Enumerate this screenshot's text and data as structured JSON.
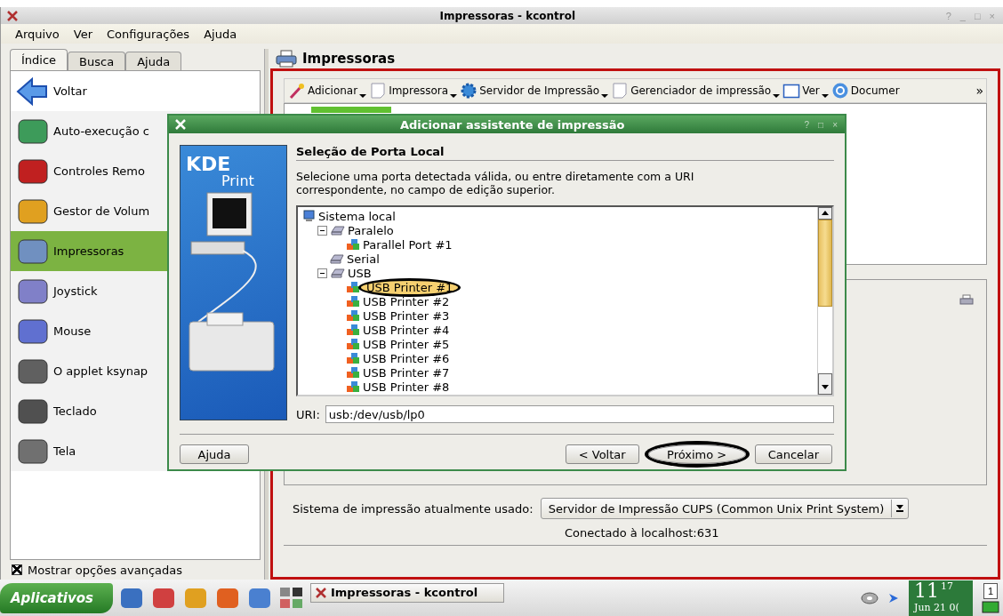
{
  "window": {
    "title": "Impressoras - kcontrol",
    "controls": [
      "?",
      "_",
      "□",
      "×"
    ]
  },
  "menu": [
    "Arquivo",
    "Ver",
    "Configurações",
    "Ajuda"
  ],
  "tabs": [
    {
      "label": "Índice",
      "selected": true
    },
    {
      "label": "Busca",
      "selected": false
    },
    {
      "label": "Ajuda",
      "selected": false
    }
  ],
  "sidebar": {
    "items": [
      {
        "label": "Voltar",
        "kind": "back",
        "selected": false
      },
      {
        "label": "Auto-execução c",
        "kind": "autorun",
        "selected": false
      },
      {
        "label": "Controles Remo",
        "kind": "remote",
        "selected": false
      },
      {
        "label": "Gestor de Volum",
        "kind": "volume",
        "selected": false
      },
      {
        "label": "Impressoras",
        "kind": "printer",
        "selected": true
      },
      {
        "label": "Joystick",
        "kind": "joystick",
        "selected": false
      },
      {
        "label": "Mouse",
        "kind": "mouse",
        "selected": false
      },
      {
        "label": "O applet ksynap",
        "kind": "touchpad",
        "selected": false
      },
      {
        "label": "Teclado",
        "kind": "keyboard",
        "selected": false
      },
      {
        "label": "Tela",
        "kind": "display",
        "selected": false
      }
    ],
    "advanced": {
      "label": "Mostrar opções avançadas",
      "checked": true
    }
  },
  "panel": {
    "title": "Impressoras",
    "toolbar": [
      {
        "label": "Adicionar",
        "kind": "wand"
      },
      {
        "label": "Impressora",
        "kind": "page"
      },
      {
        "label": "Servidor de Impressão",
        "kind": "gear"
      },
      {
        "label": "Gerenciador de impressão",
        "kind": "page"
      },
      {
        "label": "Ver",
        "kind": "window"
      },
      {
        "label": "Documer",
        "kind": "help"
      }
    ],
    "toolbar_more": "»",
    "system_label": "Sistema de impressão atualmente usado:",
    "system_value": "Servidor de Impressão CUPS (Common Unix Print System)",
    "status": "Conectado à localhost:631"
  },
  "dialog": {
    "title": "Adicionar assistente de impressão",
    "controls": [
      "?",
      "□",
      "×"
    ],
    "logo": [
      "KDE",
      "Print"
    ],
    "heading": "Seleção de Porta Local",
    "description": "Selecione uma porta detectada válida, ou entre diretamente com a URI correspondente, no campo de edição superior.",
    "tree": [
      {
        "label": "Sistema local",
        "kind": "computer",
        "selected": false,
        "children": [
          {
            "label": "Paralelo",
            "kind": "port",
            "expanded": true,
            "selected": false,
            "children": [
              {
                "label": "Parallel Port #1",
                "kind": "device",
                "selected": false
              }
            ]
          },
          {
            "label": "Serial",
            "kind": "port",
            "selected": false
          },
          {
            "label": "USB",
            "kind": "port",
            "expanded": true,
            "selected": false,
            "children": [
              {
                "label": "USB Printer #1",
                "kind": "device",
                "selected": true,
                "annotated": true
              },
              {
                "label": "USB Printer #2",
                "kind": "device",
                "selected": false
              },
              {
                "label": "USB Printer #3",
                "kind": "device",
                "selected": false
              },
              {
                "label": "USB Printer #4",
                "kind": "device",
                "selected": false
              },
              {
                "label": "USB Printer #5",
                "kind": "device",
                "selected": false
              },
              {
                "label": "USB Printer #6",
                "kind": "device",
                "selected": false
              },
              {
                "label": "USB Printer #7",
                "kind": "device",
                "selected": false
              },
              {
                "label": "USB Printer #8",
                "kind": "device",
                "selected": false
              }
            ]
          }
        ]
      }
    ],
    "uri_label": "URI:",
    "uri": "usb:/dev/usb/lp0",
    "buttons": [
      {
        "label": "Ajuda",
        "kind": "left",
        "annotated": false
      },
      {
        "label": "< Voltar",
        "kind": "right",
        "annotated": false
      },
      {
        "label": "Próximo >",
        "kind": "right",
        "annotated": true
      },
      {
        "label": "Cancelar",
        "kind": "right",
        "annotated": false
      }
    ]
  },
  "taskbar": {
    "start": "Aplicativos",
    "task": "Impressoras - kcontrol",
    "clock_hour": "11",
    "clock_min": "17",
    "clock_date": "Jun 21 0(",
    "pager": "1"
  }
}
